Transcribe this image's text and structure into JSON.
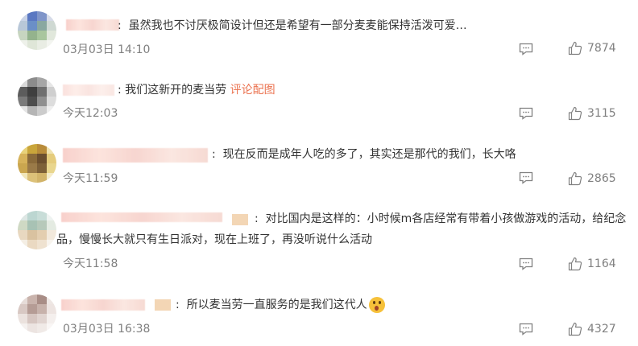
{
  "colors": {
    "link": "#eb7350",
    "meta": "#808080",
    "text": "#333333"
  },
  "icons": {
    "reply": "comment-icon",
    "like": "thumbs-up-icon"
  },
  "comments": [
    {
      "separator": ":",
      "text": "虽然我也不讨厌极简设计但还是希望有一部分麦麦能保持活泼可爱…",
      "time": "03月03日 14:10",
      "likes": "7874"
    },
    {
      "separator": ":",
      "text": "我们这新开的麦当劳",
      "link": "评论配图",
      "time": "今天12:03",
      "likes": "3115"
    },
    {
      "separator": ":",
      "text": "现在反而是成年人吃的多了，其实还是那代的我们，长大咯",
      "time": "今天11:59",
      "likes": "2865"
    },
    {
      "separator": ":",
      "text": "对比国内是这样的：小时候m各店经常有带着小孩做游戏的活动，给纪念品，慢慢长大就只有生日派对，现在上班了，再没听说什么活动",
      "time": "今天11:58",
      "likes": "1164"
    },
    {
      "separator": ":",
      "text": "所以麦当劳一直服务的是我们这代人",
      "emoji": "shocked-face-emoji",
      "time": "03月03日 16:38",
      "likes": "4327"
    }
  ]
}
